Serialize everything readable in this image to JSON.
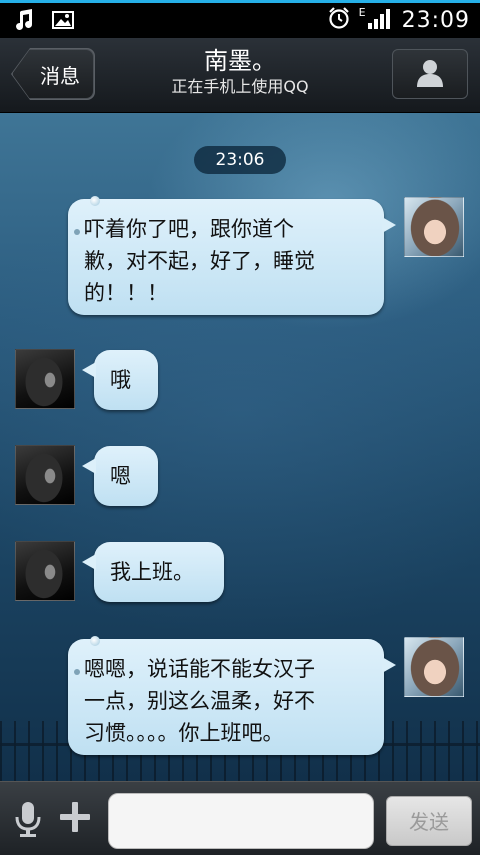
{
  "status_bar": {
    "time": "23:09",
    "network_type": "E",
    "icons": [
      "music-note-icon",
      "image-icon",
      "alarm-clock-icon",
      "signal-strength-icon"
    ]
  },
  "header": {
    "back_label": "消息",
    "contact_name": "南墨。",
    "contact_status": "正在手机上使用QQ",
    "profile_icon": "person-icon"
  },
  "chat": {
    "timestamp": "23:06",
    "messages": [
      {
        "side": "right",
        "text_lines": [
          "吓着你了吧，跟你道个",
          "歉，对不起，好了，睡觉",
          "的！！！"
        ]
      },
      {
        "side": "left",
        "text_lines": [
          "哦"
        ]
      },
      {
        "side": "left",
        "text_lines": [
          "嗯"
        ]
      },
      {
        "side": "left",
        "text_lines": [
          "我上班。"
        ]
      },
      {
        "side": "right",
        "text_lines": [
          "嗯嗯，说话能不能女汉子",
          "一点，别这么温柔，好不",
          "习惯。。。。你上班吧。"
        ]
      }
    ]
  },
  "input_bar": {
    "voice_icon": "microphone-icon",
    "plus_icon": "plus-icon",
    "text_value": "",
    "send_label": "发送"
  },
  "colors": {
    "bubble": "#cfe8f6",
    "header": "#1f2429",
    "status_accent": "#26b0e8"
  }
}
